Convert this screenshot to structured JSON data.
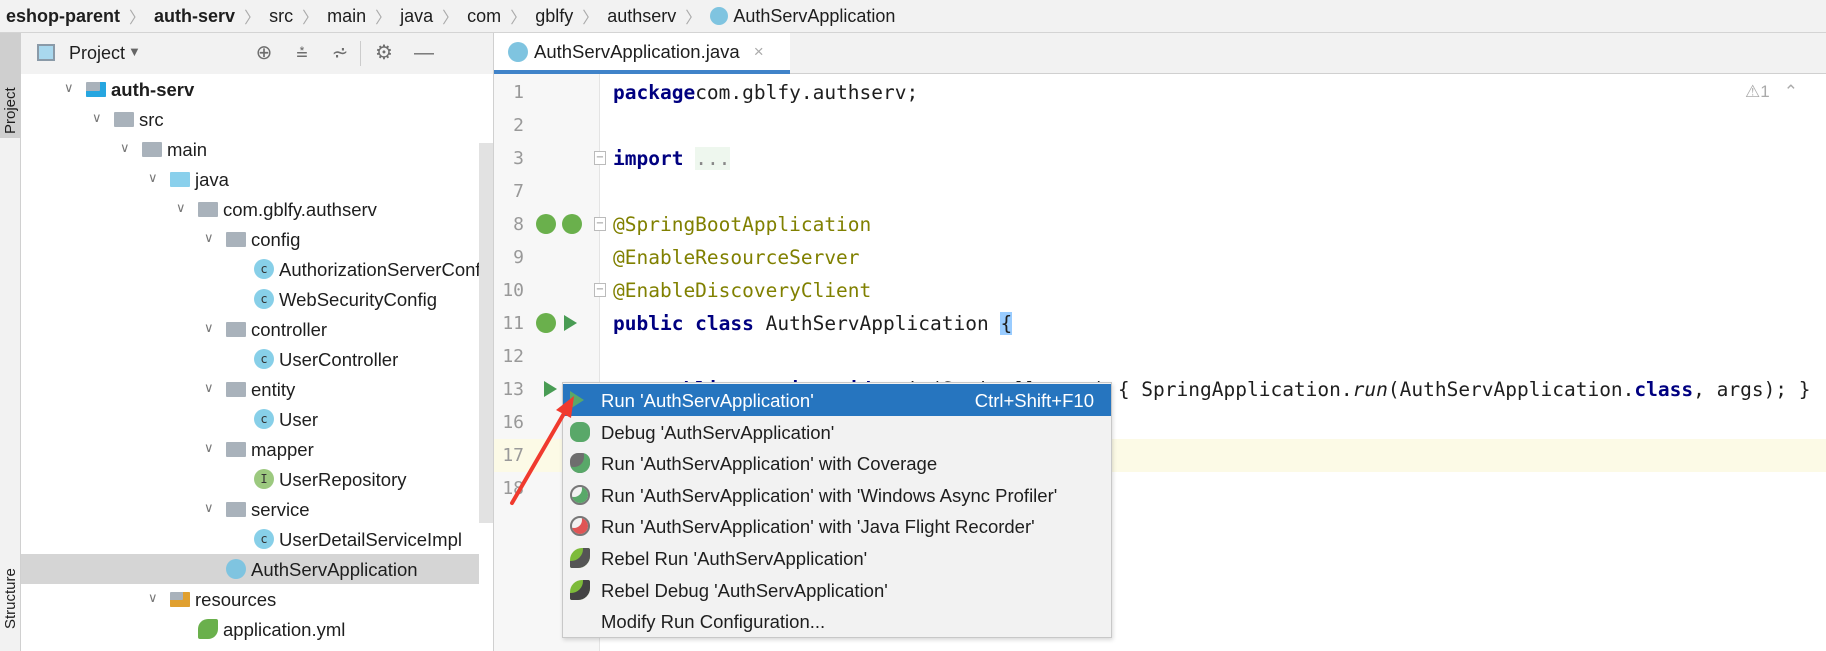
{
  "breadcrumb": [
    "eshop-parent",
    "auth-serv",
    "src",
    "main",
    "java",
    "com",
    "gblfy",
    "authserv",
    "AuthServApplication"
  ],
  "side_tabs": {
    "project": "Project",
    "structure": "Structure"
  },
  "project_panel": {
    "title": "Project",
    "tools": [
      "locate-icon",
      "expand-all-icon",
      "collapse-all-icon",
      "gear-icon",
      "hide-icon"
    ],
    "tree": [
      {
        "label": "auth-serv",
        "depth": 0,
        "type": "module",
        "expanded": true,
        "bold": true
      },
      {
        "label": "src",
        "depth": 1,
        "type": "folder",
        "expanded": true
      },
      {
        "label": "main",
        "depth": 2,
        "type": "folder",
        "expanded": true
      },
      {
        "label": "java",
        "depth": 3,
        "type": "source-folder",
        "expanded": true
      },
      {
        "label": "com.gblfy.authserv",
        "depth": 4,
        "type": "package",
        "expanded": true
      },
      {
        "label": "config",
        "depth": 5,
        "type": "package",
        "expanded": true
      },
      {
        "label": "AuthorizationServerConfig",
        "depth": 6,
        "type": "class"
      },
      {
        "label": "WebSecurityConfig",
        "depth": 6,
        "type": "class"
      },
      {
        "label": "controller",
        "depth": 5,
        "type": "package",
        "expanded": true
      },
      {
        "label": "UserController",
        "depth": 6,
        "type": "class"
      },
      {
        "label": "entity",
        "depth": 5,
        "type": "package",
        "expanded": true
      },
      {
        "label": "User",
        "depth": 6,
        "type": "class"
      },
      {
        "label": "mapper",
        "depth": 5,
        "type": "package",
        "expanded": true
      },
      {
        "label": "UserRepository",
        "depth": 6,
        "type": "interface"
      },
      {
        "label": "service",
        "depth": 5,
        "type": "package",
        "expanded": true
      },
      {
        "label": "UserDetailServiceImpl",
        "depth": 6,
        "type": "class"
      },
      {
        "label": "AuthServApplication",
        "depth": 5,
        "type": "spring-class",
        "selected": true
      },
      {
        "label": "resources",
        "depth": 3,
        "type": "resources-folder",
        "expanded": true
      },
      {
        "label": "application.yml",
        "depth": 4,
        "type": "yml"
      }
    ]
  },
  "editor": {
    "tab": "AuthServApplication.java",
    "warnings": "1",
    "current_line": "17",
    "lines": [
      {
        "n": "1",
        "seg": [
          [
            "kw",
            "package"
          ],
          [
            "",
            "com.gblfy.authserv;"
          ]
        ]
      },
      {
        "n": "2",
        "seg": []
      },
      {
        "n": "3",
        "seg": [
          [
            "kw",
            "import"
          ],
          [
            "",
            " "
          ],
          [
            "fold",
            "..."
          ]
        ]
      },
      {
        "n": "7",
        "seg": []
      },
      {
        "n": "8",
        "seg": [
          [
            "ann",
            "@SpringBootApplication"
          ]
        ]
      },
      {
        "n": "9",
        "seg": [
          [
            "ann",
            "@EnableResourceServer"
          ]
        ]
      },
      {
        "n": "10",
        "seg": [
          [
            "ann",
            "@EnableDiscoveryClient"
          ]
        ]
      },
      {
        "n": "11",
        "seg": [
          [
            "kw",
            "public class "
          ],
          [
            "",
            "AuthServApplication "
          ],
          [
            "brace",
            "{"
          ]
        ]
      },
      {
        "n": "12",
        "seg": []
      },
      {
        "n": "13",
        "seg": [
          [
            "",
            "    "
          ],
          [
            "kw",
            "public static void "
          ],
          [
            "",
            "main(String[] args) { SpringApplication."
          ],
          [
            "it",
            "run"
          ],
          [
            "",
            "(AuthServApplication."
          ],
          [
            "kw",
            "class"
          ],
          [
            "",
            ", args); }"
          ]
        ]
      },
      {
        "n": "16",
        "seg": []
      },
      {
        "n": "17",
        "seg": []
      },
      {
        "n": "18",
        "seg": []
      }
    ]
  },
  "context_menu": {
    "items": [
      {
        "label": "Run 'AuthServApplication'",
        "shortcut": "Ctrl+Shift+F10",
        "icon": "run-icon",
        "highlighted": true
      },
      {
        "label": "Debug 'AuthServApplication'",
        "icon": "debug-icon"
      },
      {
        "label": "Run 'AuthServApplication' with Coverage",
        "icon": "coverage-icon"
      },
      {
        "label": "Run 'AuthServApplication' with 'Windows Async Profiler'",
        "icon": "profiler-icon"
      },
      {
        "label": "Run 'AuthServApplication' with 'Java Flight Recorder'",
        "icon": "flight-recorder-icon"
      },
      {
        "label": "Rebel Run 'AuthServApplication'",
        "icon": "rebel-run-icon"
      },
      {
        "label": "Rebel Debug 'AuthServApplication'",
        "icon": "rebel-debug-icon"
      },
      {
        "label": "Modify Run Configuration...",
        "icon": ""
      }
    ]
  },
  "colors": {
    "accent": "#2675bf",
    "annotation": "#808000",
    "keyword": "#000080",
    "arrow": "#f03a2e"
  }
}
